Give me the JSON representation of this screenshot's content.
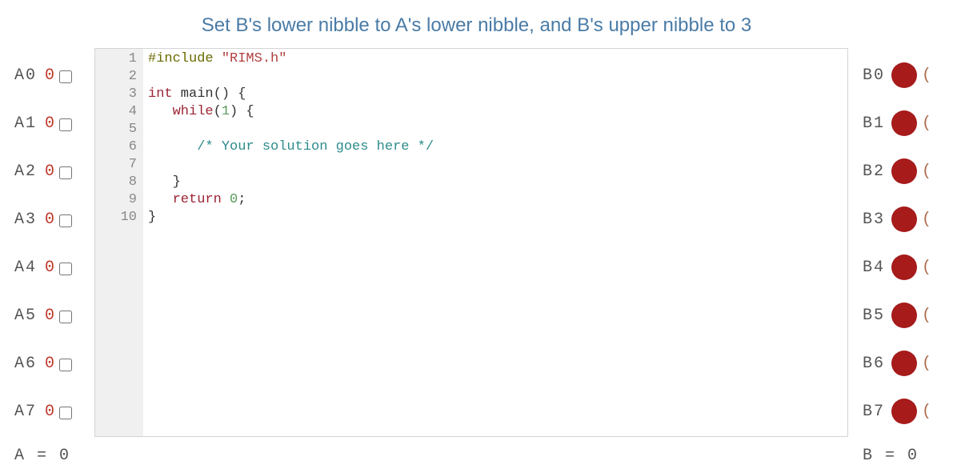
{
  "title": "Set B's lower nibble to A's lower nibble, and B's upper nibble to 3",
  "inputs": [
    {
      "label": "A0",
      "value": "0",
      "checked": false
    },
    {
      "label": "A1",
      "value": "0",
      "checked": false
    },
    {
      "label": "A2",
      "value": "0",
      "checked": false
    },
    {
      "label": "A3",
      "value": "0",
      "checked": false
    },
    {
      "label": "A4",
      "value": "0",
      "checked": false
    },
    {
      "label": "A5",
      "value": "0",
      "checked": false
    },
    {
      "label": "A6",
      "value": "0",
      "checked": false
    },
    {
      "label": "A7",
      "value": "0",
      "checked": false
    }
  ],
  "input_summary": "A = 0",
  "outputs": [
    {
      "label": "B0",
      "led_on": true,
      "extra": "("
    },
    {
      "label": "B1",
      "led_on": true,
      "extra": "("
    },
    {
      "label": "B2",
      "led_on": true,
      "extra": "("
    },
    {
      "label": "B3",
      "led_on": true,
      "extra": "("
    },
    {
      "label": "B4",
      "led_on": true,
      "extra": "("
    },
    {
      "label": "B5",
      "led_on": true,
      "extra": "("
    },
    {
      "label": "B6",
      "led_on": true,
      "extra": "("
    },
    {
      "label": "B7",
      "led_on": true,
      "extra": "("
    }
  ],
  "output_summary": "B = 0",
  "editor": {
    "line_numbers": [
      "1",
      "2",
      "3",
      "4",
      "5",
      "6",
      "7",
      "8",
      "9",
      "10"
    ],
    "lines": {
      "l1_include": "#include ",
      "l1_string": "\"RIMS.h\"",
      "l3_kw1": "int",
      "l3_rest": " main() {",
      "l4_kw": "   while",
      "l4_paren_open": "(",
      "l4_num": "1",
      "l4_paren_close": ") {",
      "l6_comment": "      /* Your solution goes here */",
      "l8_close": "   }",
      "l9_kw": "   return",
      "l9_sp": " ",
      "l9_num": "0",
      "l9_semi": ";",
      "l10_close": "}"
    }
  }
}
